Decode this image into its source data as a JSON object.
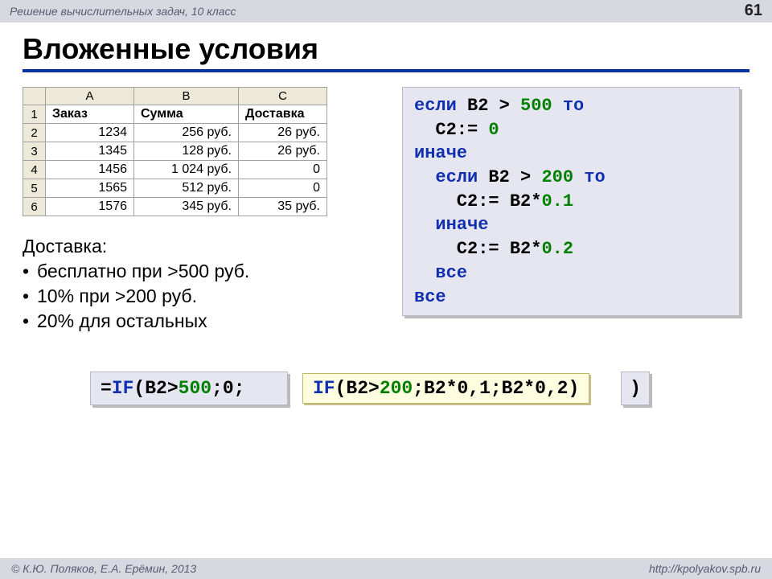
{
  "header": {
    "course": "Решение вычислительных задач, 10 класс",
    "page": "61"
  },
  "title": "Вложенные условия",
  "sheet": {
    "cols": [
      "",
      "A",
      "B",
      "C"
    ],
    "headers": [
      "Заказ",
      "Сумма",
      "Доставка"
    ],
    "rows": [
      {
        "n": "1"
      },
      {
        "n": "2",
        "a": "1234",
        "b": "256 руб.",
        "c": "26 руб."
      },
      {
        "n": "3",
        "a": "1345",
        "b": "128 руб.",
        "c": "26 руб."
      },
      {
        "n": "4",
        "a": "1456",
        "b": "1 024 руб.",
        "c": "0"
      },
      {
        "n": "5",
        "a": "1565",
        "b": "512 руб.",
        "c": "0"
      },
      {
        "n": "6",
        "a": "1576",
        "b": "345 руб.",
        "c": "35 руб."
      }
    ]
  },
  "rules": {
    "title": "Доставка:",
    "items": [
      "бесплатно при >500 руб.",
      "10% при >200 руб.",
      "20% для остальных"
    ]
  },
  "pseudo": {
    "l1_kw": "если ",
    "l1_var": "B2 > ",
    "l1_num": "500",
    "l1_then": " то",
    "l2": "  C2:= ",
    "l2_num": "0",
    "l3": "иначе",
    "l4_kw": "  если ",
    "l4_var": "B2 > ",
    "l4_num": "200",
    "l4_then": " то",
    "l5_pre": "    C2:= B2*",
    "l5_num": "0.1",
    "l6": "  иначе",
    "l7_pre": "    C2:= B2*",
    "l7_num": "0.2",
    "l8": "  все",
    "l9": "все"
  },
  "formula": {
    "eq": "=",
    "if1": "IF",
    "left_mid": "(B2>",
    "left_num": "500",
    "left_tail": ";0;",
    "if2": "IF",
    "mid_a": "(B2>",
    "mid_num": "200",
    "mid_b": ";B2*0,1;B2*0,2)",
    "rparen": ")"
  },
  "footer": {
    "left": "© К.Ю. Поляков, Е.А. Ерёмин, 2013",
    "right": "http://kpolyakov.spb.ru"
  }
}
